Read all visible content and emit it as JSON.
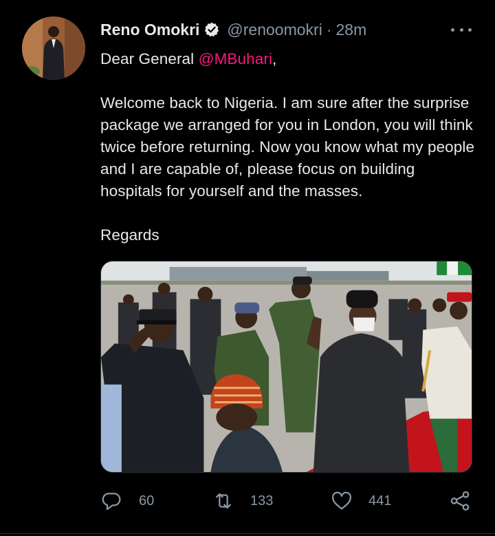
{
  "tweet": {
    "author": {
      "name": "Reno Omokri",
      "handle": "@renoomokri",
      "verified": true
    },
    "separator": "·",
    "time": "28m",
    "greeting_prefix": "Dear General ",
    "mention": "@MBuhari",
    "greeting_suffix": ",",
    "paragraph": "Welcome back to Nigeria. I am sure after the surprise package we arranged for you in London, you will think twice before returning. Now you know what my people and I are capable of, please focus on building hospitals for yourself and the masses.",
    "signoff": "Regards"
  },
  "actions": {
    "replies": "60",
    "retweets": "133",
    "likes": "441"
  },
  "colors": {
    "background": "#000000",
    "text": "#e7e9ea",
    "muted": "#8b98a5",
    "mention": "#f91880",
    "divider": "#2f3336"
  },
  "icons": [
    "verified-badge-icon",
    "more-options-icon",
    "reply-icon",
    "retweet-icon",
    "like-icon",
    "share-icon"
  ]
}
